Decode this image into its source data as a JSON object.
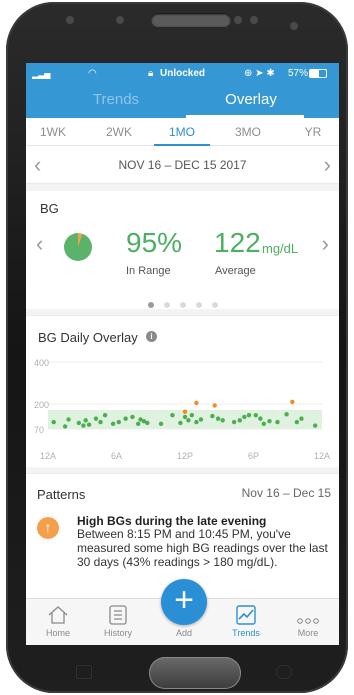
{
  "status_bar": {
    "signal": "▂▃▅",
    "wifi": "◠",
    "lock_status": "Unlocked",
    "icons_right": "⊕ ➤ ✱",
    "battery_pct": "57%"
  },
  "top_tabs": [
    {
      "label": "Trends",
      "selected": false
    },
    {
      "label": "Overlay",
      "selected": true
    }
  ],
  "range_tabs": [
    {
      "label": "1WK",
      "selected": false
    },
    {
      "label": "2WK",
      "selected": false
    },
    {
      "label": "1MO",
      "selected": true
    },
    {
      "label": "3MO",
      "selected": false
    },
    {
      "label": "YR",
      "selected": false
    }
  ],
  "date_range": "NOV 16 – DEC 15 2017",
  "bg_card": {
    "title": "BG",
    "in_range_pct": "95%",
    "in_range_label": "In Range",
    "average_value": "122",
    "average_unit": "mg/dL",
    "average_label": "Average",
    "page_dots": 5,
    "active_dot": 0
  },
  "overlay": {
    "title": "BG Daily Overlay",
    "info_icon": "info-icon"
  },
  "chart_data": {
    "type": "scatter",
    "title": "BG Daily Overlay",
    "y_ticks": [
      "400",
      "200",
      "70"
    ],
    "x_ticks": [
      "12A",
      "6A",
      "12P",
      "6P",
      "12A"
    ],
    "target_range": [
      70,
      180
    ],
    "y_axis_note": "ticks unevenly spaced: 70 sits just below 200, 400 at top",
    "colors": {
      "in_range": "#4cae4f",
      "high": "#f08a24",
      "band": "#dff1df"
    },
    "series": [
      {
        "name": "in range",
        "color": "#4cae4f",
        "points": [
          [
            0.5,
            110
          ],
          [
            1.5,
            85
          ],
          [
            1.8,
            125
          ],
          [
            2.7,
            105
          ],
          [
            3.1,
            90
          ],
          [
            3.3,
            120
          ],
          [
            3.6,
            95
          ],
          [
            4.2,
            130
          ],
          [
            4.6,
            110
          ],
          [
            5.0,
            150
          ],
          [
            5.7,
            100
          ],
          [
            6.2,
            110
          ],
          [
            6.8,
            130
          ],
          [
            7.4,
            140
          ],
          [
            7.9,
            100
          ],
          [
            8.1,
            125
          ],
          [
            8.4,
            115
          ],
          [
            8.7,
            105
          ],
          [
            9.9,
            100
          ],
          [
            10.9,
            150
          ],
          [
            11.6,
            105
          ],
          [
            12.0,
            140
          ],
          [
            12.3,
            120
          ],
          [
            12.6,
            150
          ],
          [
            13.0,
            110
          ],
          [
            13.4,
            125
          ],
          [
            14.4,
            145
          ],
          [
            14.9,
            130
          ],
          [
            15.3,
            120
          ],
          [
            16.3,
            110
          ],
          [
            16.8,
            120
          ],
          [
            17.2,
            140
          ],
          [
            17.6,
            150
          ],
          [
            18.2,
            150
          ],
          [
            18.6,
            130
          ],
          [
            18.9,
            100
          ],
          [
            19.4,
            115
          ],
          [
            20.1,
            110
          ],
          [
            20.9,
            155
          ],
          [
            21.8,
            110
          ],
          [
            22.2,
            130
          ],
          [
            23.4,
            90
          ]
        ]
      },
      {
        "name": "high",
        "color": "#f08a24",
        "points": [
          [
            12.0,
            170
          ],
          [
            13.0,
            205
          ],
          [
            14.6,
            195
          ],
          [
            21.4,
            210
          ]
        ]
      }
    ]
  },
  "patterns": {
    "title": "Patterns",
    "date_range": "Nov 16 – Dec 15",
    "icon": "arrow-up-icon",
    "headline": "High BGs during the late evening",
    "body": "Between 8:15 PM and 10:45 PM, you've measured some high BG readings over the last 30 days (43% readings > 180 mg/dL)."
  },
  "bottom_nav": [
    {
      "label": "Home",
      "icon": "home-icon",
      "active": false
    },
    {
      "label": "History",
      "icon": "history-icon",
      "active": false
    },
    {
      "label": "Add",
      "icon": "add-icon",
      "active": false
    },
    {
      "label": "Trends",
      "icon": "trends-icon",
      "active": true
    },
    {
      "label": "More",
      "icon": "more-icon",
      "active": false
    }
  ],
  "fab_symbol": "+"
}
